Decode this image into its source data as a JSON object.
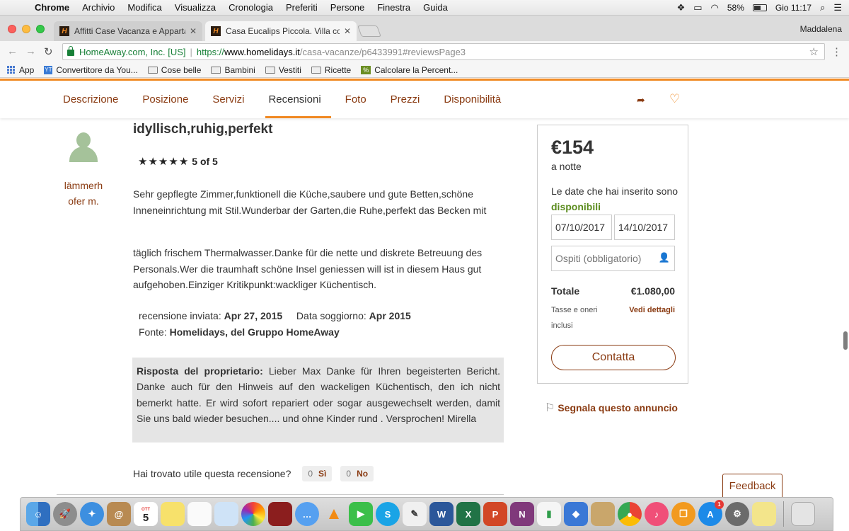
{
  "menubar": {
    "app": "Chrome",
    "items": [
      "Archivio",
      "Modifica",
      "Visualizza",
      "Cronologia",
      "Preferiti",
      "Persone",
      "Finestra",
      "Guida"
    ],
    "battery": "58%",
    "clock": "Gio 11:17"
  },
  "browser": {
    "profile": "Maddalena",
    "tabs": [
      {
        "title": "Affitti Case Vacanza e Apparta",
        "favicon": "H"
      },
      {
        "title": "Casa Eucalips Piccola. Villa co",
        "favicon": "H"
      }
    ],
    "omnibox": {
      "ev_name": "HomeAway.com, Inc. [US]",
      "scheme": "https://",
      "host": "www.homelidays.it",
      "path": "/casa-vacanze/p6433991#reviewsPage3"
    },
    "bookmarks": [
      {
        "label": "App",
        "icon": "apps-grid-icon"
      },
      {
        "label": "Convertitore da You...",
        "icon": "converter-icon"
      },
      {
        "label": "Cose belle",
        "icon": "folder-icon"
      },
      {
        "label": "Bambini",
        "icon": "folder-icon"
      },
      {
        "label": "Vestiti",
        "icon": "folder-icon"
      },
      {
        "label": "Ricette",
        "icon": "folder-icon"
      },
      {
        "label": "Calcolare la Percent...",
        "icon": "calc-icon"
      }
    ]
  },
  "page_nav": {
    "tabs": [
      "Descrizione",
      "Posizione",
      "Servizi",
      "Recensioni",
      "Foto",
      "Prezzi",
      "Disponibilità"
    ],
    "active": "Recensioni"
  },
  "review": {
    "reviewer_name": "lämmerh ofer m.",
    "title": "idyllisch,ruhig,perfekt",
    "rating_text": "5 of 5",
    "stars": 5,
    "paragraph1": "Sehr gepflegte Zimmer,funktionell die Küche,saubere und gute Betten,schöne Inneneinrichtung mit Stil.Wunderbar der Garten,die Ruhe,perfekt das Becken mit",
    "paragraph2": "täglich frischem Thermalwasser.Danke für die nette und diskrete Betreuung des Personals.Wer die traumhaft schöne Insel geniessen will ist in diesem Haus gut aufgehoben.Einziger Kritikpunkt:wackliger Küchentisch.",
    "sent_label": "recensione inviata:",
    "sent_value": "Apr 27, 2015",
    "stay_label": "Data soggiorno:",
    "stay_value": "Apr 2015",
    "source_label": "Fonte:",
    "source_value": "Homelidays, del Gruppo HomeAway",
    "owner_label": "Risposta del proprietario:",
    "owner_text": "Lieber Max Danke für Ihren begeisterten Bericht. Danke auch für den Hinweis auf den wackeligen Küchentisch, den ich nicht bemerkt hatte. Er wird sofort repariert oder sogar ausgewechselt werden, damit Sie uns bald wieder besuchen.... und ohne Kinder rund . Versprochen! Mirella",
    "helpful_question": "Hai trovato utile questa recensione?",
    "yes_count": "0",
    "yes_label": "Sì",
    "no_count": "0",
    "no_label": "No"
  },
  "booking": {
    "price": "€154",
    "per": "a notte",
    "avail_prefix": "Le date che hai inserito sono",
    "avail_status": "disponibili",
    "checkin": "07/10/2017",
    "checkout": "14/10/2017",
    "guests_placeholder": "Ospiti (obbligatorio)",
    "total_label": "Totale",
    "total_amount": "€1.080,00",
    "tax_note": "Tasse e oneri inclusi",
    "details_link": "Vedi dettagli",
    "contact_button": "Contatta"
  },
  "report_link": "Segnala questo annuncio",
  "feedback_button": "Feedback",
  "dock": {
    "calendar_day": "5",
    "calendar_month": "OTT",
    "appstore_badge": "1",
    "apps": [
      "finder",
      "launchpad",
      "safari",
      "contacts",
      "calendar",
      "notes",
      "reminders",
      "preview",
      "photos",
      "photo-booth",
      "messages",
      "vlc",
      "facetime",
      "skype",
      "textedit",
      "word",
      "excel",
      "powerpoint",
      "onenote",
      "numbers",
      "keynote",
      "preview-2",
      "chrome",
      "itunes",
      "ibooks",
      "app-store",
      "system-preferences",
      "stickies",
      "trash"
    ]
  },
  "colors": {
    "brand_orange": "#f08a24",
    "link_brown": "#8a3b12",
    "available_green": "#5b8c1e"
  }
}
